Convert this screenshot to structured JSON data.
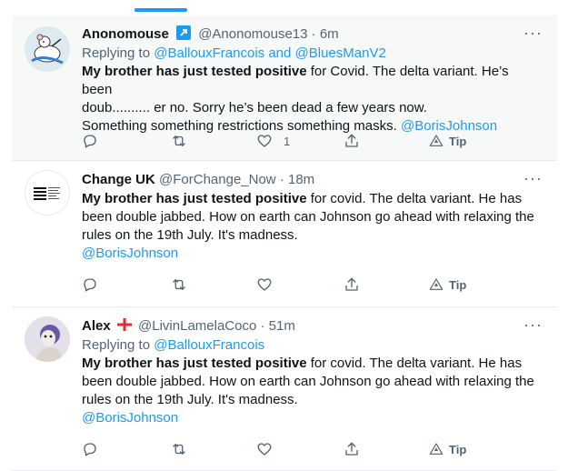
{
  "tweets": [
    {
      "name": "Anonomouse",
      "handle": "@Anonomouse13",
      "time": "· 6m",
      "reply_prefix": "Replying to",
      "reply_to": "@BallouxFrancois and @BluesManV2",
      "text_bold": "My brother has just tested positive",
      "text_line1_rest": " for Covid. The delta variant. He’s been",
      "text_line2": "doub.......... er no. Sorry he’s been dead a few years now.",
      "text_line3_plain": "Something something restrictions something masks. ",
      "text_line3_link": "@BorisJohnson",
      "like_count": "1",
      "tip_label": "Tip",
      "more": "···"
    },
    {
      "name": "Change UK",
      "handle": "@ForChange_Now",
      "time": "· 18m",
      "text_bold": "My brother has just tested positive",
      "text_line1_rest": " for covid. The delta variant. He has",
      "text_line2": "been double jabbed. How on earth can Johnson go ahead with relaxing the",
      "text_line3": "rules on the 19th July. It's madness.",
      "text_line4_link": "@BorisJohnson",
      "tip_label": "Tip",
      "more": "···"
    },
    {
      "name": "Alex",
      "handle": "@LivinLamelaCoco",
      "time": "· 51m",
      "reply_prefix": "Replying to",
      "reply_to": "@BallouxFrancois",
      "text_bold": "My brother has just tested positive",
      "text_line1_rest": " for covid. The delta variant. He has",
      "text_line2": "been double jabbed. How on earth can Johnson go ahead with relaxing the",
      "text_line3": "rules on the 19th July. It's madness.",
      "text_line4_link": "@BorisJohnson",
      "tip_label": "Tip",
      "more": "···"
    }
  ],
  "colors": {
    "accent": "#1d9bf0",
    "muted": "#536471",
    "text": "#0f1419",
    "highlight_bg": "#f7f9f9"
  },
  "icons": [
    "reply-icon",
    "retweet-icon",
    "like-icon",
    "share-icon",
    "tip-icon",
    "more-icon",
    "verified-icon",
    "england-flag-icon"
  ]
}
